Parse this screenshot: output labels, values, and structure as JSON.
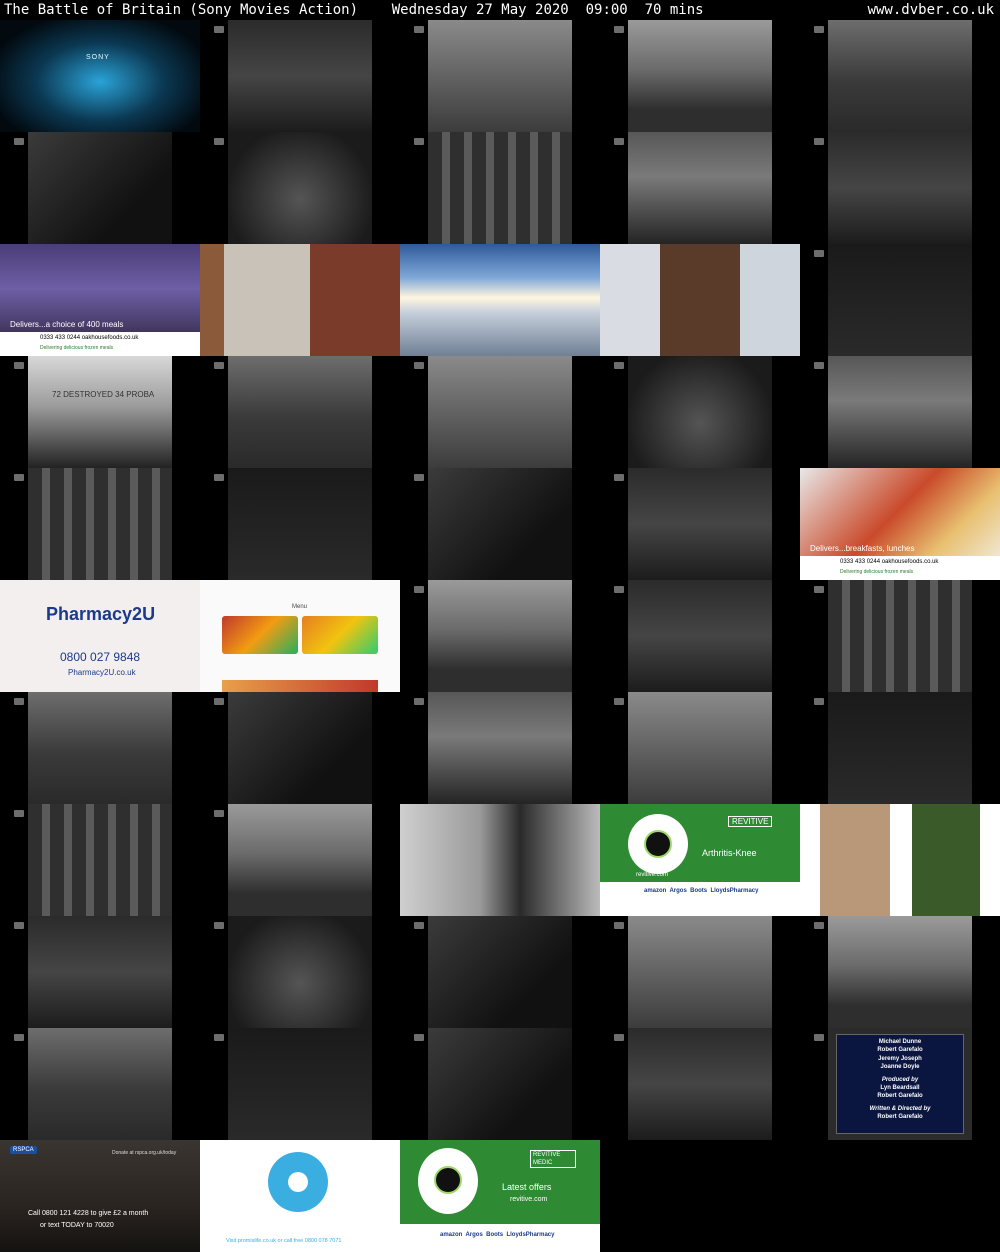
{
  "header": {
    "title": "The Battle of Britain (Sony Movies Action)    Wednesday 27 May 2020  09:00  70 mins",
    "site": "www.dvber.co.uk"
  },
  "thumbs": {
    "sony": {
      "brand": "SONY"
    },
    "oakhouse1": {
      "caption": "Delivers...a choice of 400 meals",
      "phone": "0333 433 0244  oakhousefoods.co.uk",
      "tagline": "Delivering delicious frozen meals"
    },
    "oakhouse2": {
      "caption": "Delivers...breakfasts, lunches",
      "phone": "0333 433 0244  oakhousefoods.co.uk",
      "tagline": "Delivering delicious frozen meals"
    },
    "destroyed": {
      "text": "72 DESTROYED 34 PROBA"
    },
    "pharmacy": {
      "brand": "Pharmacy2U",
      "phone": "0800 027 9848",
      "url": "Pharmacy2U.co.uk"
    },
    "menu": {
      "title": "Menu"
    },
    "revitive1": {
      "brand": "REVITIVE",
      "product": "Arthritis-Knee",
      "logo_text": "revitive.com",
      "retailers": "amazon  Argos  Boots  LloydsPharmacy"
    },
    "credits": {
      "lines": [
        "Michael Dunne",
        "Robert Garefalo",
        "Jeremy Joseph",
        "Joanne Doyle",
        "Produced by",
        "Lyn Beardsall",
        "Robert Garefalo",
        "Written & Directed by",
        "Robert Garefalo"
      ]
    },
    "rspca": {
      "badge": "RSPCA",
      "line1": "Call 0800 121 4228 to give £2 a month",
      "line2": "or text TODAY to 70020",
      "top": "Donate at rspca.org.uk/today"
    },
    "promis": {
      "footer": "Visit promislife.co.uk or call free 0800 078 7071"
    },
    "revitive2": {
      "brand": "REVITIVE MEDIC",
      "offer": "Latest offers",
      "url": "revitive.com",
      "retailers": "amazon  Argos  Boots  LloydsPharmacy"
    }
  }
}
